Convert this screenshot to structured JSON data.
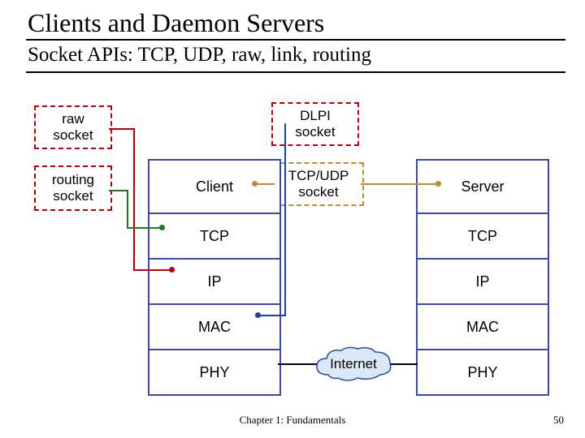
{
  "title": "Clients and Daemon Servers",
  "subtitle": "Socket APIs: TCP, UDP, raw, link, routing",
  "boxes": {
    "raw": {
      "l1": "raw",
      "l2": "socket"
    },
    "routing": {
      "l1": "routing",
      "l2": "socket"
    },
    "dlpi": {
      "l1": "DLPI",
      "l2": "socket"
    },
    "tcpudp": {
      "l1": "TCP/UDP",
      "l2": "socket"
    }
  },
  "client_stack": {
    "top": "Client",
    "tcp": "TCP",
    "ip": "IP",
    "mac": "MAC",
    "phy": "PHY"
  },
  "server_stack": {
    "top": "Server",
    "tcp": "TCP",
    "ip": "IP",
    "mac": "MAC",
    "phy": "PHY"
  },
  "internet": "Internet",
  "footer": "Chapter 1: Fundamentals",
  "page": "50"
}
